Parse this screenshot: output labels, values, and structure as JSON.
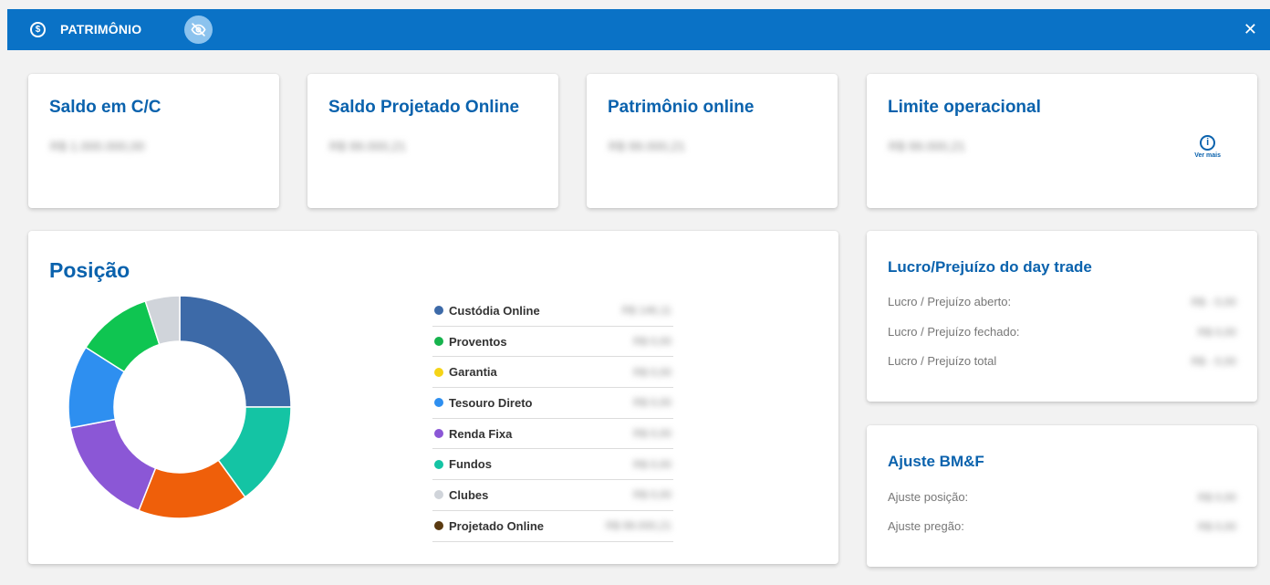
{
  "header": {
    "title": "PATRIMÔNIO",
    "close_label": "✕",
    "icons": [
      "dollar-circle-icon",
      "eye-off-icon",
      "close-icon"
    ]
  },
  "summary_cards": [
    {
      "title": "Saldo em C/C",
      "value": "R$ 1.000.000,00"
    },
    {
      "title": "Saldo Projetado Online",
      "value": "R$ 99.000,21"
    },
    {
      "title": "Patrimônio online",
      "value": "R$ 99.000,21"
    },
    {
      "title": "Limite operacional",
      "value": "R$ 99.000,21",
      "more_label": "Ver mais"
    }
  ],
  "position": {
    "title": "Posição",
    "items": [
      {
        "name": "Custódia Online",
        "value": "R$ 146,11",
        "color": "#3d6aa8"
      },
      {
        "name": "Proventos",
        "value": "R$ 0,00",
        "color": "#16b34d"
      },
      {
        "name": "Garantia",
        "value": "R$ 0,00",
        "color": "#f5d417"
      },
      {
        "name": "Tesouro Direto",
        "value": "R$ 0,00",
        "color": "#2e8ff0"
      },
      {
        "name": "Renda Fixa",
        "value": "R$ 0,00",
        "color": "#8b57d6"
      },
      {
        "name": "Fundos",
        "value": "R$ 0,00",
        "color": "#14c4a4"
      },
      {
        "name": "Clubes",
        "value": "R$ 0,00",
        "color": "#d0d4da"
      },
      {
        "name": "Projetado Online",
        "value": "R$ 99.000,21",
        "color": "#5a3a10"
      }
    ],
    "chart_segments": [
      {
        "color": "#3d6aa8",
        "value": 25
      },
      {
        "color": "#14c4a4",
        "value": 15
      },
      {
        "color": "#ef5f0a",
        "value": 16
      },
      {
        "color": "#8b57d6",
        "value": 16
      },
      {
        "color": "#2e8ff0",
        "value": 12
      },
      {
        "color": "#0fc551",
        "value": 11
      },
      {
        "color": "#d0d4da",
        "value": 5
      }
    ]
  },
  "day_trade": {
    "title": "Lucro/Prejuízo do day trade",
    "rows": [
      {
        "label": "Lucro / Prejuízo aberto:",
        "value": "R$ - 0,00"
      },
      {
        "label": "Lucro / Prejuízo fechado:",
        "value": "R$ 0,00"
      },
      {
        "label": "Lucro / Prejuízo total",
        "value": "R$ - 0,00"
      }
    ]
  },
  "bmf": {
    "title": "Ajuste BM&F",
    "rows": [
      {
        "label": "Ajuste posição:",
        "value": "R$ 0,00"
      },
      {
        "label": "Ajuste pregão:",
        "value": "R$ 0,00"
      }
    ]
  }
}
